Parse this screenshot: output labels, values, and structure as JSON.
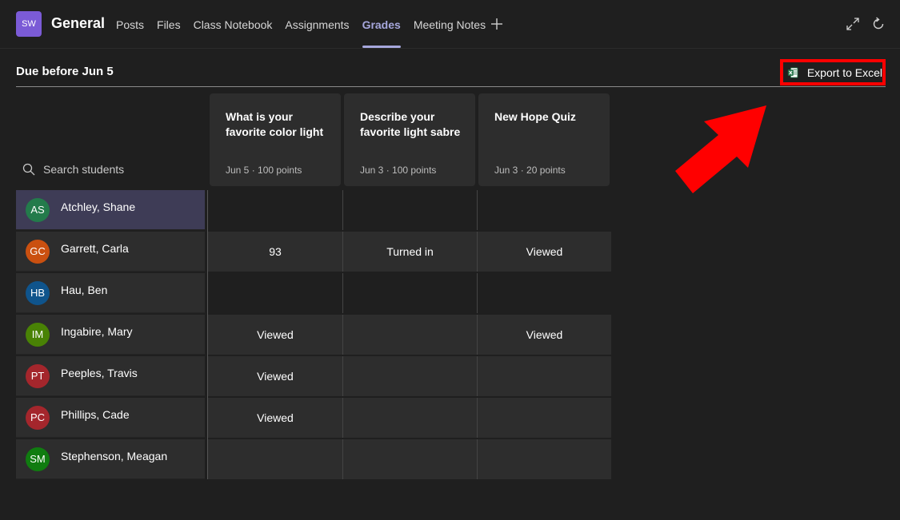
{
  "header": {
    "team_initials": "SW",
    "channel_name": "General",
    "tabs": [
      {
        "label": "Posts",
        "active": false
      },
      {
        "label": "Files",
        "active": false
      },
      {
        "label": "Class Notebook",
        "active": false
      },
      {
        "label": "Assignments",
        "active": false
      },
      {
        "label": "Grades",
        "active": true
      },
      {
        "label": "Meeting Notes",
        "active": false
      }
    ],
    "icons": [
      "add-tab-icon",
      "expand-icon",
      "refresh-icon"
    ]
  },
  "due_title": "Due before Jun 5",
  "export": {
    "label": "Export to Excel",
    "icon": "excel-icon"
  },
  "search": {
    "label": "Search students",
    "icon": "search-icon"
  },
  "assignments": [
    {
      "title": "What is your favorite color light",
      "date": "Jun 5",
      "points": "100 points"
    },
    {
      "title": "Describe your favorite light sabre",
      "date": "Jun 3",
      "points": "100 points"
    },
    {
      "title": "New Hope Quiz",
      "date": "Jun 3",
      "points": "20 points"
    }
  ],
  "students": [
    {
      "initials": "AS",
      "name": "Atchley, Shane",
      "color": "#237b4b",
      "selected": true,
      "cells": [
        "",
        "",
        ""
      ]
    },
    {
      "initials": "GC",
      "name": "Garrett, Carla",
      "color": "#ca5010",
      "selected": false,
      "cells": [
        "93",
        "Turned in",
        "Viewed"
      ]
    },
    {
      "initials": "HB",
      "name": "Hau, Ben",
      "color": "#0f548c",
      "selected": false,
      "cells": [
        "",
        "",
        ""
      ]
    },
    {
      "initials": "IM",
      "name": "Ingabire, Mary",
      "color": "#498205",
      "selected": false,
      "cells": [
        "Viewed",
        "",
        "Viewed"
      ]
    },
    {
      "initials": "PT",
      "name": "Peeples, Travis",
      "color": "#a4262c",
      "selected": false,
      "cells": [
        "Viewed",
        "",
        ""
      ]
    },
    {
      "initials": "PC",
      "name": "Phillips, Cade",
      "color": "#a4262c",
      "selected": false,
      "cells": [
        "Viewed",
        "",
        ""
      ]
    },
    {
      "initials": "SM",
      "name": "Stephenson, Meagan",
      "color": "#107c10",
      "selected": false,
      "cells": [
        "",
        "",
        ""
      ]
    }
  ],
  "colors": {
    "accent": "#a6a7dc",
    "team_avatar": "#7b5bd6",
    "highlight_box": "#ff0000"
  }
}
